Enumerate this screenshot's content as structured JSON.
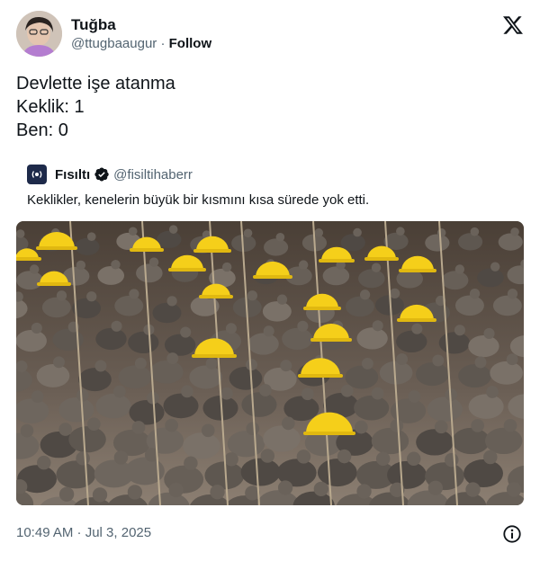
{
  "tweet": {
    "display_name": "Tuğba",
    "handle": "@ttugbaaugur",
    "separator": "·",
    "follow_label": "Follow",
    "lines": [
      "Devlette işe atanma",
      "Keklik: 1",
      "Ben: 0"
    ],
    "timestamp": "10:49 AM · Jul 3, 2025"
  },
  "quote": {
    "name": "Fısıltı",
    "handle": "@fisiltihaberr",
    "text": "Keklikler, kenelerin büyük bir kısmını kısa sürede yok etti."
  },
  "icons": {
    "brand": "x-logo-icon",
    "verified": "verified-badge-icon",
    "info": "info-icon"
  },
  "colors": {
    "text": "#0f1419",
    "secondary": "#536471",
    "helmet": "#f5cf1a"
  }
}
